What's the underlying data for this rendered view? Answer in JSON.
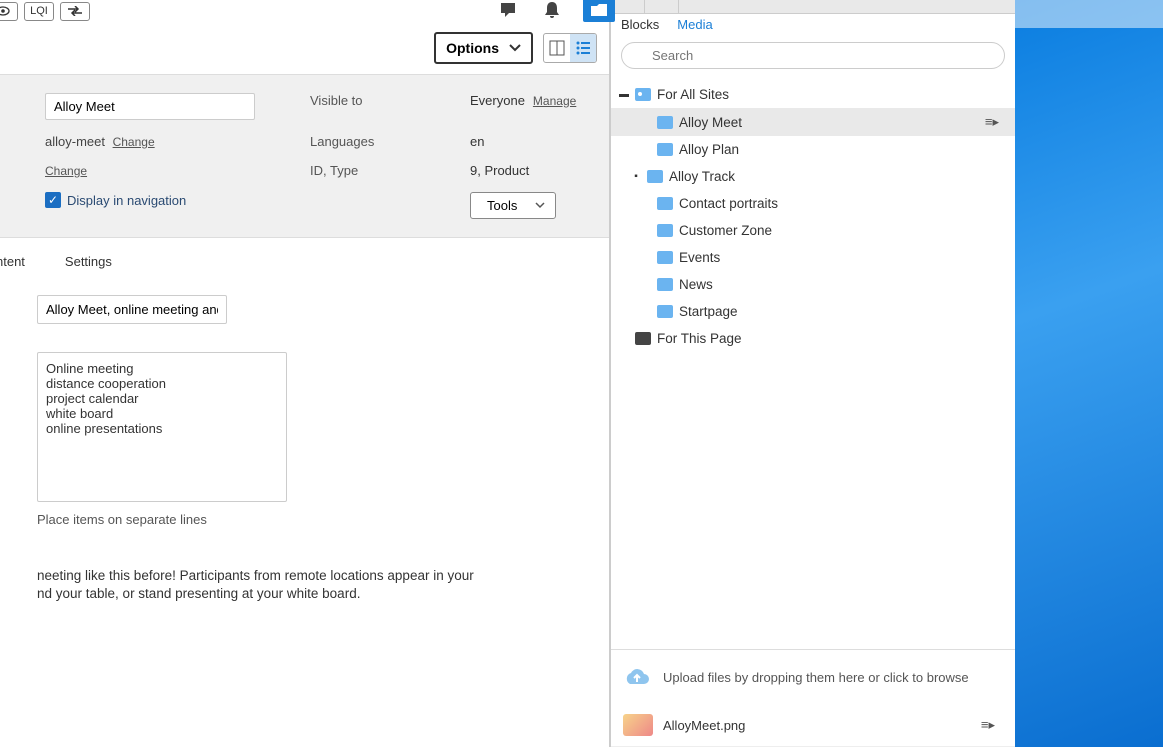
{
  "topbar": {
    "lqi": "LQI"
  },
  "options": {
    "label": "Options"
  },
  "form": {
    "title_value": "Alloy Meet",
    "slug": "alloy-meet",
    "change": "Change",
    "change2": "Change",
    "visible_to_label": "Visible to",
    "visible_to_value": "Everyone",
    "manage": "Manage",
    "languages_label": "Languages",
    "languages_value": "en",
    "idtype_label": "ID, Type",
    "idtype_value": "9, Product",
    "display_nav": "Display in navigation",
    "tools": "Tools"
  },
  "tabs": {
    "content": "ntent",
    "settings": "Settings"
  },
  "seo": {
    "title_value": "Alloy Meet, online meeting and",
    "keywords": "Online meeting\ndistance cooperation\nproject calendar\nwhite board\nonline presentations",
    "hint": "Place items on separate lines",
    "description": "neeting like this before! Participants from remote locations appear in your\nnd your table, or stand presenting at your white board."
  },
  "side": {
    "tabs": {
      "blocks": "Blocks",
      "media": "Media"
    },
    "search_placeholder": "Search",
    "root1": "For All Sites",
    "items": [
      "Alloy Meet",
      "Alloy Plan",
      "Alloy Track",
      "Contact portraits",
      "Customer Zone",
      "Events",
      "News",
      "Startpage"
    ],
    "root2": "For This Page",
    "dropzone": "Upload files by dropping them here or click to browse",
    "file": "AlloyMeet.png"
  }
}
